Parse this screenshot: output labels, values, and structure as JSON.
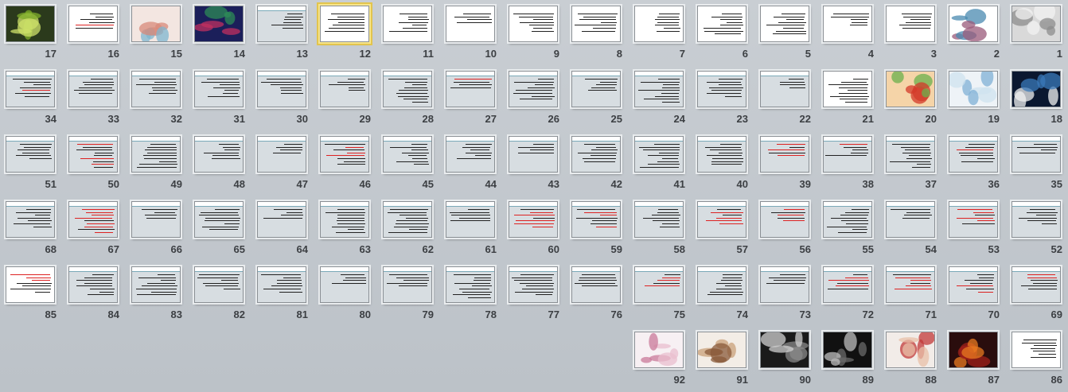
{
  "view": "Slide Sorter",
  "selected_slide": 12,
  "slides": [
    {
      "n": 17,
      "style": "image",
      "colors": [
        "#2b3a1c",
        "#7fae2a",
        "#cfe26a"
      ]
    },
    {
      "n": 16,
      "style": "text-white",
      "red": true
    },
    {
      "n": 15,
      "style": "image",
      "colors": [
        "#f3e6e1",
        "#d88a7a",
        "#7fb6cf"
      ]
    },
    {
      "n": 14,
      "style": "image",
      "colors": [
        "#1b1f5a",
        "#2e8b57",
        "#c03060"
      ]
    },
    {
      "n": 13,
      "style": "gray"
    },
    {
      "n": 12,
      "style": "text-white"
    },
    {
      "n": 11,
      "style": "text-white"
    },
    {
      "n": 10,
      "style": "text-white"
    },
    {
      "n": 9,
      "style": "text-white"
    },
    {
      "n": 8,
      "style": "text-white"
    },
    {
      "n": 7,
      "style": "text-white"
    },
    {
      "n": 6,
      "style": "text-white"
    },
    {
      "n": 5,
      "style": "text-white"
    },
    {
      "n": 4,
      "style": "text-white"
    },
    {
      "n": 3,
      "style": "text-white"
    },
    {
      "n": 2,
      "style": "image",
      "colors": [
        "#ffffff",
        "#9a5a7a",
        "#4a8ab0"
      ]
    },
    {
      "n": 1,
      "style": "image",
      "colors": [
        "#d9d9d9",
        "#8c8c8c",
        "#f2f2f2"
      ]
    },
    {
      "n": 34,
      "style": "gray",
      "red": true
    },
    {
      "n": 33,
      "style": "gray"
    },
    {
      "n": 32,
      "style": "gray"
    },
    {
      "n": 31,
      "style": "gray"
    },
    {
      "n": 30,
      "style": "gray"
    },
    {
      "n": 29,
      "style": "gray"
    },
    {
      "n": 28,
      "style": "gray"
    },
    {
      "n": 27,
      "style": "gray",
      "red": true
    },
    {
      "n": 26,
      "style": "gray"
    },
    {
      "n": 25,
      "style": "gray"
    },
    {
      "n": 24,
      "style": "gray"
    },
    {
      "n": 23,
      "style": "gray"
    },
    {
      "n": 22,
      "style": "gray"
    },
    {
      "n": 21,
      "style": "text-white"
    },
    {
      "n": 20,
      "style": "image",
      "colors": [
        "#f5d4a8",
        "#d33a2a",
        "#6ab04c"
      ]
    },
    {
      "n": 19,
      "style": "image",
      "colors": [
        "#eef3f7",
        "#7fb0d6",
        "#cfe3ef"
      ]
    },
    {
      "n": 18,
      "style": "image",
      "colors": [
        "#0b1830",
        "#3a78b8",
        "#f0f0f0"
      ]
    },
    {
      "n": 51,
      "style": "gray"
    },
    {
      "n": 50,
      "style": "gray",
      "red": true
    },
    {
      "n": 49,
      "style": "gray"
    },
    {
      "n": 48,
      "style": "gray"
    },
    {
      "n": 47,
      "style": "gray"
    },
    {
      "n": 46,
      "style": "gray",
      "red": true
    },
    {
      "n": 45,
      "style": "gray"
    },
    {
      "n": 44,
      "style": "gray",
      "red": true
    },
    {
      "n": 43,
      "style": "gray"
    },
    {
      "n": 42,
      "style": "gray"
    },
    {
      "n": 41,
      "style": "gray"
    },
    {
      "n": 40,
      "style": "gray"
    },
    {
      "n": 39,
      "style": "gray",
      "red": true
    },
    {
      "n": 38,
      "style": "gray",
      "red": true
    },
    {
      "n": 37,
      "style": "gray"
    },
    {
      "n": 36,
      "style": "gray",
      "red": true
    },
    {
      "n": 35,
      "style": "gray"
    },
    {
      "n": 68,
      "style": "gray"
    },
    {
      "n": 67,
      "style": "gray",
      "red": true
    },
    {
      "n": 66,
      "style": "gray"
    },
    {
      "n": 65,
      "style": "gray"
    },
    {
      "n": 64,
      "style": "gray"
    },
    {
      "n": 63,
      "style": "gray"
    },
    {
      "n": 62,
      "style": "gray"
    },
    {
      "n": 61,
      "style": "gray"
    },
    {
      "n": 60,
      "style": "gray",
      "red": true
    },
    {
      "n": 59,
      "style": "gray",
      "red": true
    },
    {
      "n": 58,
      "style": "gray"
    },
    {
      "n": 57,
      "style": "gray",
      "red": true
    },
    {
      "n": 56,
      "style": "gray",
      "red": true
    },
    {
      "n": 55,
      "style": "gray"
    },
    {
      "n": 54,
      "style": "gray"
    },
    {
      "n": 53,
      "style": "gray",
      "red": true
    },
    {
      "n": 52,
      "style": "gray"
    },
    {
      "n": 85,
      "style": "text-white",
      "red": true
    },
    {
      "n": 84,
      "style": "gray"
    },
    {
      "n": 83,
      "style": "gray"
    },
    {
      "n": 82,
      "style": "gray"
    },
    {
      "n": 81,
      "style": "gray"
    },
    {
      "n": 80,
      "style": "gray",
      "red": true
    },
    {
      "n": 79,
      "style": "gray"
    },
    {
      "n": 78,
      "style": "gray"
    },
    {
      "n": 77,
      "style": "gray"
    },
    {
      "n": 76,
      "style": "gray"
    },
    {
      "n": 75,
      "style": "gray",
      "red": true
    },
    {
      "n": 74,
      "style": "gray"
    },
    {
      "n": 73,
      "style": "gray"
    },
    {
      "n": 72,
      "style": "gray",
      "red": true
    },
    {
      "n": 71,
      "style": "gray",
      "red": true
    },
    {
      "n": 70,
      "style": "gray",
      "red": true
    },
    {
      "n": 69,
      "style": "gray",
      "red": true
    },
    {
      "n": 92,
      "style": "image",
      "colors": [
        "#f7f0f3",
        "#c97a9a",
        "#e9bfcf"
      ]
    },
    {
      "n": 91,
      "style": "image",
      "colors": [
        "#f3ede6",
        "#c9a07a",
        "#8a5a3a"
      ]
    },
    {
      "n": 90,
      "style": "image",
      "colors": [
        "#1a1a1a",
        "#8a8a8a",
        "#d0d0d0"
      ]
    },
    {
      "n": 89,
      "style": "image",
      "colors": [
        "#111111",
        "#6a6a6a",
        "#bdbdbd"
      ]
    },
    {
      "n": 88,
      "style": "image",
      "colors": [
        "#f2ece8",
        "#c23a3a",
        "#e8c0a8"
      ]
    },
    {
      "n": 87,
      "style": "image",
      "colors": [
        "#2a0d0d",
        "#a0201a",
        "#e87a20"
      ]
    },
    {
      "n": 86,
      "style": "text-white"
    }
  ]
}
